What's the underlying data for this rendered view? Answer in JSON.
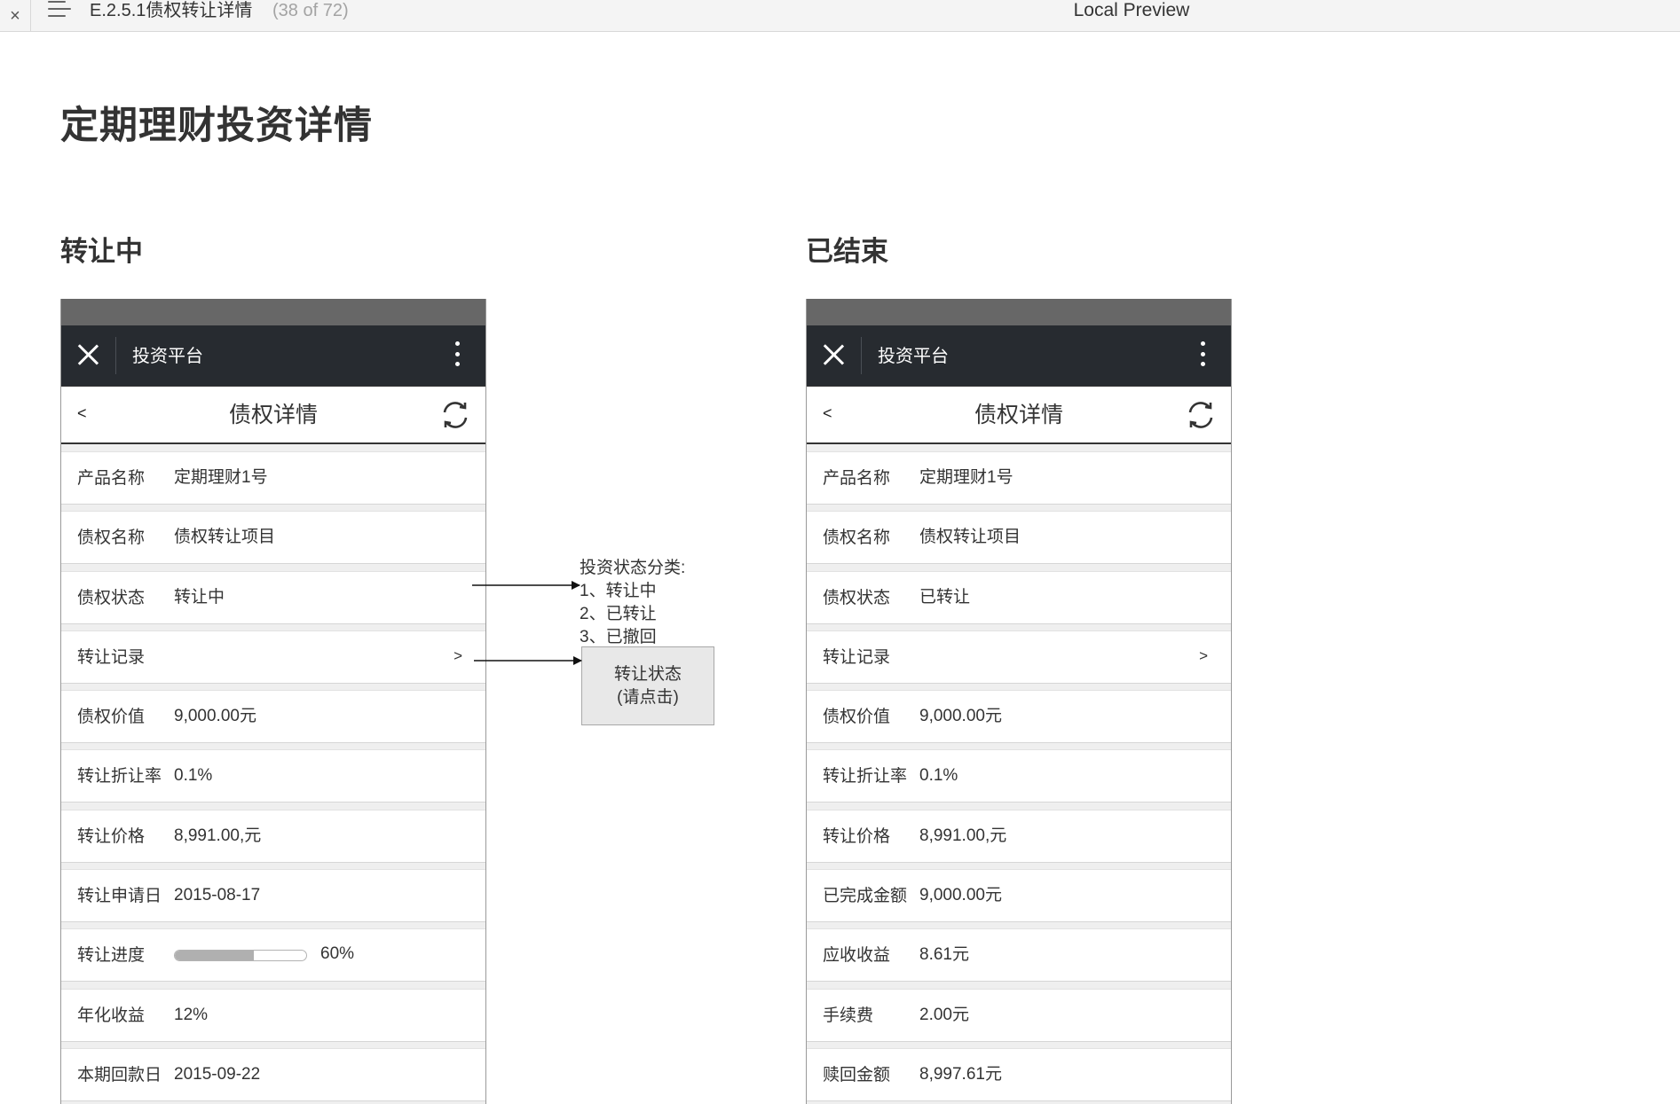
{
  "toolbar": {
    "close_glyph": "×",
    "title": "E.2.5.1债权转让详情",
    "page_count": "(38 of 72)",
    "preview_label": "Local Preview"
  },
  "page_title": "定期理财投资详情",
  "sections": {
    "left_title": "转让中",
    "right_title": "已结束"
  },
  "phone": {
    "app_name": "投资平台",
    "back_label": "<",
    "nav_title": "债权详情"
  },
  "left_rows": [
    {
      "label": "产品名称",
      "value": "定期理财1号"
    },
    {
      "label": "债权名称",
      "value": "债权转让项目"
    },
    {
      "label": "债权状态",
      "value": "转让中"
    },
    {
      "label": "转让记录",
      "chevron": ">"
    },
    {
      "label": "债权价值",
      "value": "9,000.00元"
    },
    {
      "label": "转让折让率",
      "value": "0.1%"
    },
    {
      "label": "转让价格",
      "value": "8,991.00,元"
    },
    {
      "label": "转让申请日",
      "value": "2015-08-17"
    },
    {
      "label": "转让进度",
      "progress_percent": 60,
      "progress_text": "60%"
    },
    {
      "label": "年化收益",
      "value": "12%"
    },
    {
      "label": "本期回款日",
      "value": "2015-09-22"
    }
  ],
  "right_rows": [
    {
      "label": "产品名称",
      "value": "定期理财1号"
    },
    {
      "label": "债权名称",
      "value": "债权转让项目"
    },
    {
      "label": "债权状态",
      "value": "已转让"
    },
    {
      "label": "转让记录",
      "chevron": ">"
    },
    {
      "label": "债权价值",
      "value": "9,000.00元"
    },
    {
      "label": "转让折让率",
      "value": "0.1%"
    },
    {
      "label": "转让价格",
      "value": "8,991.00,元"
    },
    {
      "label": "已完成金额",
      "value": "9,000.00元"
    },
    {
      "label": "应收收益",
      "value": "8.61元"
    },
    {
      "label": "手续费",
      "value": "2.00元"
    },
    {
      "label": "赎回金额",
      "value": "8,997.61元"
    }
  ],
  "annotation": {
    "status_note": [
      "投资状态分类:",
      "1、转让中",
      "2、已转让",
      "3、已撤回"
    ],
    "box_line1": "转让状态",
    "box_line2": "(请点击)"
  }
}
